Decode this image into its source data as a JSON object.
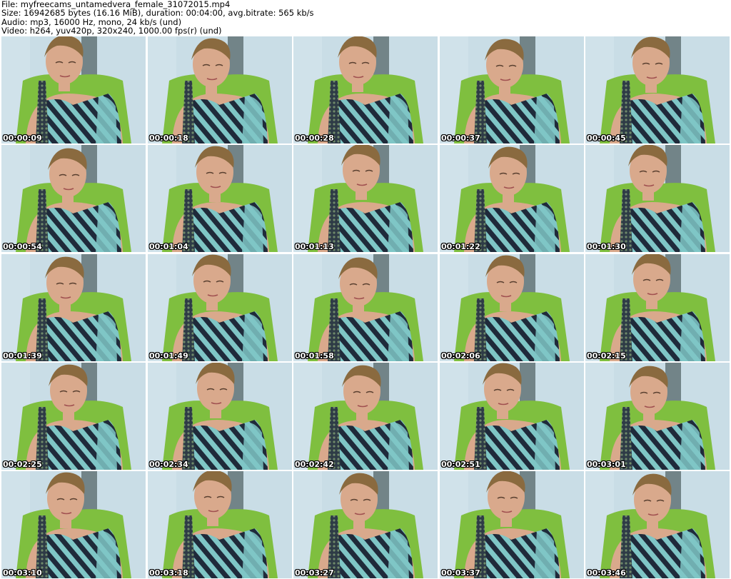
{
  "header": {
    "file_line": "File: myfreecams_untamedvera_female_31072015.mp4",
    "size_line": "Size: 16942685 bytes (16.16 MiB), duration: 00:04:00, avg.bitrate: 565 kb/s",
    "audio_line": "Audio: mp3, 16000 Hz, mono, 24 kb/s (und)",
    "video_line": "Video: h264, yuv420p, 320x240, 1000.00 fps(r) (und)"
  },
  "grid": {
    "columns": 5,
    "rows": 5
  },
  "thumbnails": [
    {
      "timestamp": "00:00:09"
    },
    {
      "timestamp": "00:00:18"
    },
    {
      "timestamp": "00:00:28"
    },
    {
      "timestamp": "00:00:37"
    },
    {
      "timestamp": "00:00:45"
    },
    {
      "timestamp": "00:00:54"
    },
    {
      "timestamp": "00:01:04"
    },
    {
      "timestamp": "00:01:13"
    },
    {
      "timestamp": "00:01:22"
    },
    {
      "timestamp": "00:01:30"
    },
    {
      "timestamp": "00:01:39"
    },
    {
      "timestamp": "00:01:49"
    },
    {
      "timestamp": "00:01:58"
    },
    {
      "timestamp": "00:02:06"
    },
    {
      "timestamp": "00:02:15"
    },
    {
      "timestamp": "00:02:25"
    },
    {
      "timestamp": "00:02:34"
    },
    {
      "timestamp": "00:02:42"
    },
    {
      "timestamp": "00:02:51"
    },
    {
      "timestamp": "00:03:01"
    },
    {
      "timestamp": "00:03:10"
    },
    {
      "timestamp": "00:03:18"
    },
    {
      "timestamp": "00:03:27"
    },
    {
      "timestamp": "00:03:37"
    },
    {
      "timestamp": "00:03:46"
    }
  ],
  "colors": {
    "wall": "#c9dde6",
    "chair": "#7fbf3f",
    "skin": "#d9a98c",
    "hair": "#8a6a3f",
    "stripe_dark": "#1f2a3a",
    "stripe_light": "#7fc6c6",
    "panel_dark": "#2e3b46"
  }
}
